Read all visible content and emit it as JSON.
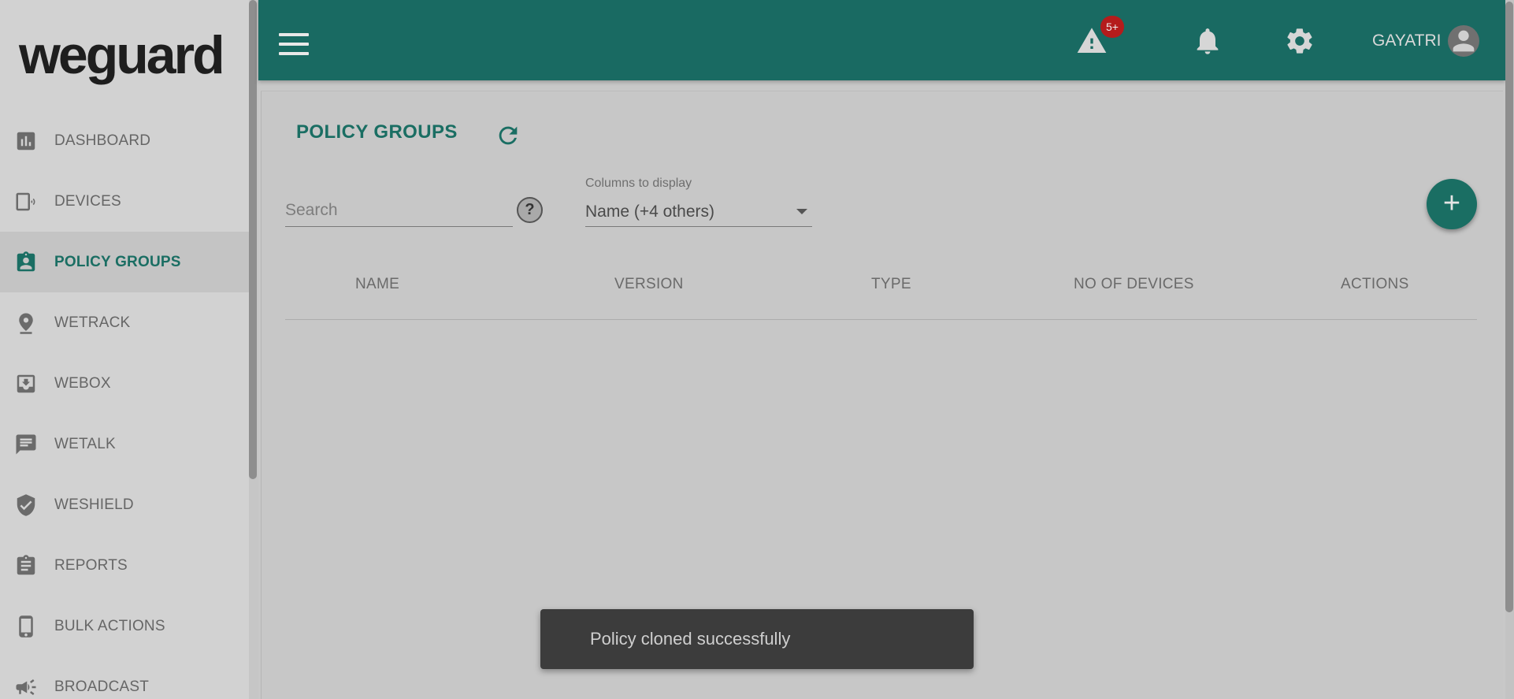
{
  "brand": {
    "logo_text": "weguard"
  },
  "sidebar": {
    "items": [
      {
        "label": "DASHBOARD",
        "icon": "bar-chart-icon",
        "active": false
      },
      {
        "label": "DEVICES",
        "icon": "device-icon",
        "active": false
      },
      {
        "label": "POLICY GROUPS",
        "icon": "badge-icon",
        "active": true
      },
      {
        "label": "WETRACK",
        "icon": "location-pin-icon",
        "active": false
      },
      {
        "label": "WEBOX",
        "icon": "download-box-icon",
        "active": false
      },
      {
        "label": "WETALK",
        "icon": "chat-icon",
        "active": false
      },
      {
        "label": "WESHIELD",
        "icon": "shield-check-icon",
        "active": false
      },
      {
        "label": "REPORTS",
        "icon": "clipboard-icon",
        "active": false
      },
      {
        "label": "BULK ACTIONS",
        "icon": "phone-icon",
        "active": false
      },
      {
        "label": "BROADCAST",
        "icon": "megaphone-icon",
        "active": false
      }
    ]
  },
  "topbar": {
    "alert_badge": "5+",
    "username": "GAYATRI"
  },
  "main": {
    "title": "POLICY GROUPS",
    "search": {
      "placeholder": "Search",
      "value": ""
    },
    "help_label": "?",
    "columns_select": {
      "label": "Columns to display",
      "value": "Name (+4 others)"
    },
    "fab_label": "+",
    "table": {
      "columns": [
        "NAME",
        "VERSION",
        "TYPE",
        "NO OF DEVICES",
        "ACTIONS"
      ],
      "rows": []
    }
  },
  "toast": {
    "message": "Policy cloned successfully"
  },
  "colors": {
    "primary": "#196a62",
    "accent": "#1a6e63",
    "badge": "#b41c1c",
    "toast_bg": "#3c3c3c"
  }
}
